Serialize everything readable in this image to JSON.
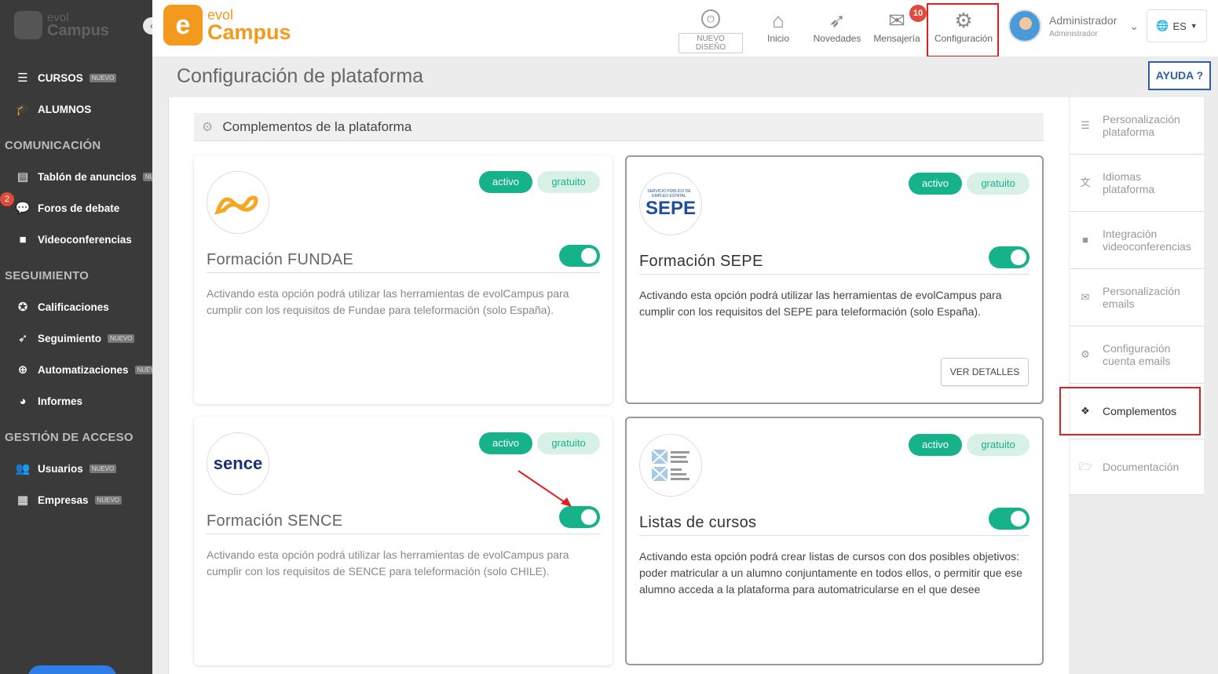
{
  "sidebar": {
    "logo_top": "evol",
    "logo_bottom": "Campus",
    "items": {
      "cursos": "CURSOS",
      "alumnos": "ALUMNOS",
      "tablon": "Tablón de anuncios",
      "foros": "Foros de debate",
      "videoconf": "Videoconferencias",
      "calificaciones": "Calificaciones",
      "seguimiento": "Seguimiento",
      "automatizaciones": "Automatizaciones",
      "informes": "Informes",
      "usuarios": "Usuarios",
      "empresas": "Empresas"
    },
    "sections": {
      "comunicacion": "COMUNICACIÓN",
      "seguimiento": "SEGUIMIENTO",
      "gestion": "GESTIÓN DE ACCESO"
    },
    "nuevo_label": "NUEVO",
    "foros_badge": "2"
  },
  "topbar": {
    "brand_top": "evol",
    "brand_bottom": "Campus",
    "nuevo_diseno": "NUEVO DISEÑO",
    "inicio": "Inicio",
    "novedades": "Novedades",
    "mensajeria": "Mensajería",
    "mensajeria_badge": "10",
    "configuracion": "Configuración",
    "user_name": "Administrador",
    "user_role": "Administrador",
    "lang": "ES"
  },
  "page": {
    "title": "Configuración de plataforma",
    "help": "AYUDA ?"
  },
  "section": {
    "title": "Complementos de la plataforma"
  },
  "cards": [
    {
      "title": "Formación FUNDAE",
      "status": "activo",
      "price": "gratuito",
      "enabled": true,
      "desc": "Activando esta opción podrá utilizar las herramientas de evolCampus para cumplir con los requisitos de Fundae para teleformación (solo España)."
    },
    {
      "title": "Formación SEPE",
      "status": "activo",
      "price": "gratuito",
      "enabled": true,
      "logo_small": "SERVICIO PÚBLICO DE EMPLEO ESTATAL",
      "logo_big": "SEPE",
      "desc": "Activando esta opción podrá utilizar las herramientas de evolCampus para cumplir con los requisitos del SEPE para teleformación (solo España).",
      "details_btn": "VER DETALLES"
    },
    {
      "title": "Formación SENCE",
      "status": "activo",
      "price": "gratuito",
      "enabled": true,
      "logo_text": "sence",
      "desc": "Activando esta opción podrá utilizar las herramientas de evolCampus para cumplir con los requisitos de SENCE para teleformación (solo CHILE)."
    },
    {
      "title": "Listas de cursos",
      "status": "activo",
      "price": "gratuito",
      "enabled": true,
      "desc": "Activando esta opción podrá crear listas de cursos con dos posibles objetivos: poder matricular a un alumno conjuntamente en todos ellos, o permitir que ese alumno acceda a la plataforma para automatricularse en el que desee"
    }
  ],
  "right_menu": {
    "personalizacion": "Personalización plataforma",
    "idiomas": "Idiomas plataforma",
    "integracion": "Integración videoconferencias",
    "emails": "Personalización emails",
    "cuenta_emails": "Configuración cuenta emails",
    "complementos": "Complementos",
    "documentacion": "Documentación"
  },
  "colors": {
    "sidebar_bg": "#3a3a3a",
    "brand_orange": "#f39a1e",
    "accent_green": "#16b38a",
    "highlight_red": "#e02020",
    "help_blue": "#2d5fa6"
  }
}
